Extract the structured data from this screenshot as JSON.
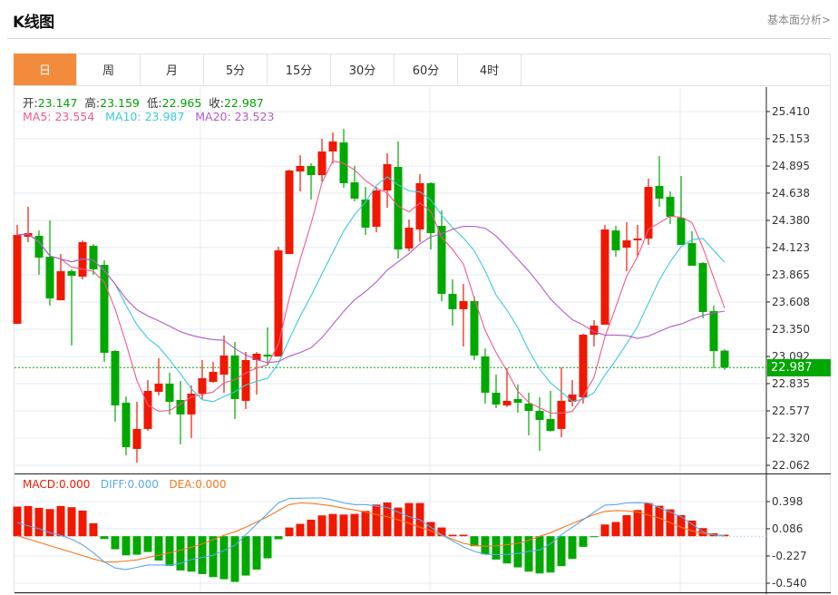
{
  "header": {
    "title": "K线图",
    "more_link": "基本面分析>"
  },
  "tabs": [
    "日",
    "周",
    "月",
    "5分",
    "15分",
    "30分",
    "60分",
    "4时"
  ],
  "active_tab": 0,
  "ohlc_info": {
    "open_label": "开:",
    "open": "23.147",
    "high_label": "高:",
    "high": "23.159",
    "low_label": "低:",
    "low": "22.965",
    "close_label": "收:",
    "close": "22.987"
  },
  "ma_info": {
    "ma5": "MA5: 23.554",
    "ma10": "MA10: 23.987",
    "ma20": "MA20: 23.523"
  },
  "macd_info": {
    "macd": "MACD:0.000",
    "diff": "DIFF:0.000",
    "dea": "DEA:0.000"
  },
  "colors": {
    "up": "#f01800",
    "down": "#00a800",
    "ma5": "#ef5a8a",
    "ma10": "#3cc8dc",
    "ma20": "#b45ac8",
    "diff": "#5aa8ee",
    "dea": "#f5781e",
    "accent": "#f28c3c"
  },
  "chart_data": [
    {
      "type": "candlestick",
      "title": "K线图",
      "y_ticks": [
        "25.410",
        "25.153",
        "24.895",
        "24.638",
        "24.380",
        "24.123",
        "23.865",
        "23.608",
        "23.350",
        "23.092",
        "22.835",
        "22.577",
        "22.320",
        "22.062"
      ],
      "ylim": [
        22.062,
        25.41
      ],
      "last_price": "22.987",
      "ohlc": [
        [
          23.401,
          24.337,
          23.401,
          24.242
        ],
        [
          24.225,
          24.509,
          24.174,
          24.26
        ],
        [
          24.234,
          24.285,
          23.865,
          24.028
        ],
        [
          24.036,
          24.38,
          23.573,
          23.642
        ],
        [
          23.624,
          24.062,
          23.624,
          23.899
        ],
        [
          23.899,
          23.916,
          23.196,
          23.856
        ],
        [
          23.848,
          24.191,
          23.822,
          24.174
        ],
        [
          24.139,
          24.157,
          23.865,
          23.916
        ],
        [
          23.959,
          24.002,
          23.04,
          23.127
        ],
        [
          23.144,
          23.152,
          22.474,
          22.629
        ],
        [
          22.654,
          22.714,
          22.157,
          22.234
        ],
        [
          22.217,
          22.663,
          22.088,
          22.406
        ],
        [
          22.406,
          22.869,
          22.388,
          22.766
        ],
        [
          22.757,
          23.075,
          22.723,
          22.835
        ],
        [
          22.835,
          22.938,
          22.543,
          22.663
        ],
        [
          22.68,
          22.86,
          22.26,
          22.543
        ],
        [
          22.543,
          22.818,
          22.32,
          22.74
        ],
        [
          22.74,
          23.058,
          22.689,
          22.886
        ],
        [
          22.852,
          23.04,
          22.843,
          22.946
        ],
        [
          22.92,
          23.29,
          22.749,
          23.101
        ],
        [
          23.101,
          23.23,
          22.5,
          22.689
        ],
        [
          22.672,
          23.135,
          22.594,
          23.058
        ],
        [
          23.058,
          23.135,
          22.732,
          23.118
        ],
        [
          23.109,
          23.367,
          23.006,
          23.092
        ],
        [
          23.092,
          24.131,
          23.092,
          24.096
        ],
        [
          24.062,
          24.861,
          24.062,
          24.852
        ],
        [
          24.843,
          24.998,
          24.654,
          24.895
        ],
        [
          24.895,
          24.921,
          24.577,
          24.809
        ],
        [
          24.809,
          25.153,
          24.749,
          25.032
        ],
        [
          25.032,
          25.213,
          24.921,
          25.127
        ],
        [
          25.118,
          25.247,
          24.689,
          24.732
        ],
        [
          24.74,
          24.895,
          24.56,
          24.586
        ],
        [
          24.577,
          24.697,
          24.242,
          24.311
        ],
        [
          24.32,
          24.697,
          24.268,
          24.663
        ],
        [
          24.663,
          25.015,
          24.5,
          24.912
        ],
        [
          24.886,
          25.127,
          24.019,
          24.105
        ],
        [
          24.114,
          24.388,
          24.088,
          24.311
        ],
        [
          24.294,
          24.818,
          24.174,
          24.732
        ],
        [
          24.732,
          24.74,
          24.105,
          24.26
        ],
        [
          24.328,
          24.474,
          23.616,
          23.685
        ],
        [
          23.685,
          23.822,
          23.384,
          23.539
        ],
        [
          23.539,
          23.779,
          23.187,
          23.616
        ],
        [
          23.616,
          23.659,
          23.058,
          23.101
        ],
        [
          23.092,
          23.17,
          22.646,
          22.749
        ],
        [
          22.749,
          22.92,
          22.603,
          22.637
        ],
        [
          22.629,
          22.981,
          22.612,
          22.672
        ],
        [
          22.689,
          22.826,
          22.56,
          22.654
        ],
        [
          22.646,
          22.749,
          22.345,
          22.577
        ],
        [
          22.577,
          22.706,
          22.199,
          22.491
        ],
        [
          22.5,
          22.766,
          22.38,
          22.388
        ],
        [
          22.406,
          22.989,
          22.328,
          22.672
        ],
        [
          22.663,
          22.869,
          22.62,
          22.732
        ],
        [
          22.706,
          23.307,
          22.646,
          23.298
        ],
        [
          23.298,
          23.436,
          23.187,
          23.384
        ],
        [
          23.393,
          24.337,
          23.393,
          24.294
        ],
        [
          24.285,
          24.328,
          24.036,
          24.096
        ],
        [
          24.122,
          24.363,
          23.899,
          24.191
        ],
        [
          24.191,
          24.337,
          24.036,
          24.208
        ],
        [
          24.208,
          24.775,
          24.148,
          24.697
        ],
        [
          24.706,
          24.989,
          24.509,
          24.586
        ],
        [
          24.603,
          24.654,
          24.346,
          24.414
        ],
        [
          24.405,
          24.8,
          24.148,
          24.148
        ],
        [
          24.165,
          24.277,
          23.951,
          23.951
        ],
        [
          23.976,
          23.985,
          23.453,
          23.513
        ],
        [
          23.521,
          23.573,
          22.981,
          23.144
        ],
        [
          23.147,
          23.159,
          22.965,
          22.987
        ]
      ],
      "ma_periods": [
        5,
        10,
        20
      ]
    },
    {
      "type": "bar",
      "title": "MACD",
      "y_ticks": [
        "0.398",
        "0.086",
        "-0.227",
        "-0.540"
      ],
      "ylim": [
        -0.54,
        0.398
      ],
      "macd": [
        0.34,
        0.347,
        0.326,
        0.312,
        0.347,
        0.333,
        0.295,
        0.149,
        -0.032,
        -0.15,
        -0.219,
        -0.212,
        -0.181,
        -0.279,
        -0.341,
        -0.393,
        -0.407,
        -0.435,
        -0.47,
        -0.494,
        -0.525,
        -0.452,
        -0.383,
        -0.254,
        -0.035,
        0.1,
        0.142,
        0.19,
        0.239,
        0.256,
        0.249,
        0.256,
        0.291,
        0.364,
        0.388,
        0.329,
        0.381,
        0.381,
        0.163,
        0.1,
        0.017,
        0.017,
        -0.115,
        -0.209,
        -0.268,
        -0.313,
        -0.358,
        -0.407,
        -0.428,
        -0.417,
        -0.344,
        -0.261,
        -0.122,
        -0.011,
        0.135,
        0.163,
        0.242,
        0.301,
        0.381,
        0.35,
        0.308,
        0.242,
        0.18,
        0.093,
        0.034,
        0.017
      ],
      "diff": [
        0.156,
        0.121,
        0.086,
        0.041,
        0.01,
        -0.035,
        -0.098,
        -0.192,
        -0.296,
        -0.365,
        -0.383,
        -0.358,
        -0.331,
        -0.331,
        -0.331,
        -0.313,
        -0.268,
        -0.244,
        -0.219,
        -0.164,
        -0.105,
        0.017,
        0.138,
        0.26,
        0.382,
        0.434,
        0.437,
        0.44,
        0.44,
        0.416,
        0.382,
        0.364,
        0.364,
        0.347,
        0.329,
        0.277,
        0.225,
        0.19,
        0.103,
        0.017,
        -0.053,
        -0.122,
        -0.174,
        -0.209,
        -0.212,
        -0.209,
        -0.199,
        -0.174,
        -0.157,
        -0.088,
        0.017,
        0.103,
        0.19,
        0.277,
        0.357,
        0.364,
        0.382,
        0.385,
        0.382,
        0.329,
        0.277,
        0.225,
        0.138,
        0.051,
        0.017,
        0.006
      ],
      "dea": [
        0.006,
        -0.032,
        -0.07,
        -0.108,
        -0.147,
        -0.185,
        -0.223,
        -0.261,
        -0.296,
        -0.296,
        -0.285,
        -0.272,
        -0.244,
        -0.219,
        -0.191,
        -0.16,
        -0.126,
        -0.088,
        -0.039,
        0.01,
        0.051,
        0.103,
        0.163,
        0.225,
        0.295,
        0.364,
        0.382,
        0.378,
        0.364,
        0.347,
        0.322,
        0.301,
        0.277,
        0.249,
        0.225,
        0.19,
        0.149,
        0.103,
        0.062,
        0.01,
        -0.035,
        -0.081,
        -0.105,
        -0.115,
        -0.112,
        -0.098,
        -0.081,
        -0.046,
        -0.001,
        0.041,
        0.093,
        0.145,
        0.197,
        0.249,
        0.284,
        0.295,
        0.291,
        0.277,
        0.242,
        0.208,
        0.156,
        0.103,
        0.062,
        0.034,
        0.017,
        0.006
      ]
    }
  ]
}
